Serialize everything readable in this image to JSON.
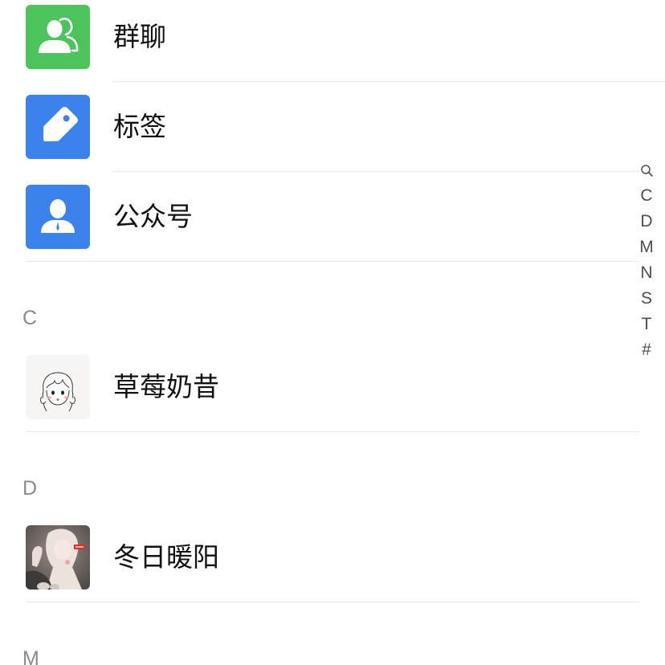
{
  "features": [
    {
      "label": "群聊",
      "icon": "group-chat-icon",
      "color": "#4cc35d"
    },
    {
      "label": "标签",
      "icon": "tag-icon",
      "color": "#3b83ea"
    },
    {
      "label": "公众号",
      "icon": "official-account-icon",
      "color": "#3b83ea"
    }
  ],
  "sections": [
    {
      "letter": "C",
      "contacts": [
        {
          "name": "草莓奶昔",
          "avatar": "sketch-girl-avatar"
        }
      ]
    },
    {
      "letter": "D",
      "contacts": [
        {
          "name": "冬日暖阳",
          "avatar": "anime-girl-avatar"
        }
      ]
    },
    {
      "letter": "M",
      "contacts": []
    }
  ],
  "index_bar": {
    "search_icon": "search-icon",
    "letters": [
      "C",
      "D",
      "M",
      "N",
      "S",
      "T",
      "#"
    ]
  },
  "colors": {
    "text": "#111111",
    "section_letter": "#8a8a8a",
    "index_letter": "#4d4d4d",
    "divider": "#e7e7e7"
  }
}
